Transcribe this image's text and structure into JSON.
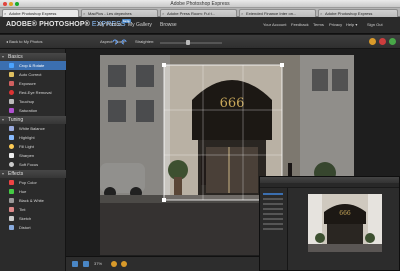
{
  "window": {
    "title": "Adobe Photoshop Express"
  },
  "tabs": [
    {
      "label": "Adobe Photoshop Express",
      "active": true
    },
    {
      "label": "MacPics - Les depeches",
      "active": false
    },
    {
      "label": "Adobe Press Room: Ful t...",
      "active": false
    },
    {
      "label": "Extended Finance Inter on...",
      "active": false
    },
    {
      "label": "Adobe Photoshop Express",
      "active": false
    }
  ],
  "app": {
    "logo_main": "ADOBE® PHOTOSHOP®",
    "logo_express": "EXPRESS",
    "beta": "beta",
    "nav": [
      "My Photos",
      "My Gallery",
      "Browse"
    ],
    "top_links": [
      "Your Account",
      "Feedback",
      "Terms",
      "Privacy",
      "Help ▾",
      "Sign Out"
    ]
  },
  "toolbar": {
    "back_label": "◂ Back to My Photos",
    "aspect_label": "Aspect:",
    "aspect_value": "None",
    "straighten_label": "Straighten:"
  },
  "sidebar": {
    "sections": [
      {
        "label": "Basics",
        "items": [
          {
            "label": "Crop & Rotate",
            "active": true,
            "icon": "crop-icon",
            "color": "#4aa3ff"
          },
          {
            "label": "Auto Correct",
            "active": false,
            "icon": "magic-wand-icon",
            "color": "#e0c060"
          },
          {
            "label": "Exposure",
            "active": false,
            "icon": "exposure-icon",
            "color": "#d06060"
          },
          {
            "label": "Red-Eye Removal",
            "active": false,
            "icon": "red-eye-icon",
            "color": "#d33"
          },
          {
            "label": "Touchup",
            "active": false,
            "icon": "touchup-icon",
            "color": "#bbb"
          },
          {
            "label": "Saturation",
            "active": false,
            "icon": "saturation-icon",
            "color": "#b050d0"
          }
        ]
      },
      {
        "label": "Tuning",
        "items": [
          {
            "label": "White Balance",
            "active": false,
            "icon": "white-balance-icon",
            "color": "#9ad"
          },
          {
            "label": "Highlight",
            "active": false,
            "icon": "highlight-icon",
            "color": "#8bf"
          },
          {
            "label": "Fill Light",
            "active": false,
            "icon": "fill-light-icon",
            "color": "#fc5"
          },
          {
            "label": "Sharpen",
            "active": false,
            "icon": "sharpen-icon",
            "color": "#eee"
          },
          {
            "label": "Soft Focus",
            "active": false,
            "icon": "soft-focus-icon",
            "color": "#ccc"
          }
        ]
      },
      {
        "label": "Effects",
        "items": [
          {
            "label": "Pop Color",
            "active": false,
            "icon": "pop-color-icon",
            "color": "#e44"
          },
          {
            "label": "Hue",
            "active": false,
            "icon": "hue-icon",
            "color": "#4c4"
          },
          {
            "label": "Black & White",
            "active": false,
            "icon": "black-white-icon",
            "color": "#999"
          },
          {
            "label": "Tint",
            "active": false,
            "icon": "tint-icon",
            "color": "#d88"
          },
          {
            "label": "Sketch",
            "active": false,
            "icon": "sketch-icon",
            "color": "#ccc"
          },
          {
            "label": "Distort",
            "active": false,
            "icon": "distort-icon",
            "color": "#8ad"
          }
        ]
      }
    ]
  },
  "photo": {
    "address_number": "666"
  },
  "bottombar": {
    "zoom": "37%"
  },
  "colors": {
    "accent": "#3b6fb0",
    "awning": "#1c1814",
    "gold": "#c9a85a"
  }
}
